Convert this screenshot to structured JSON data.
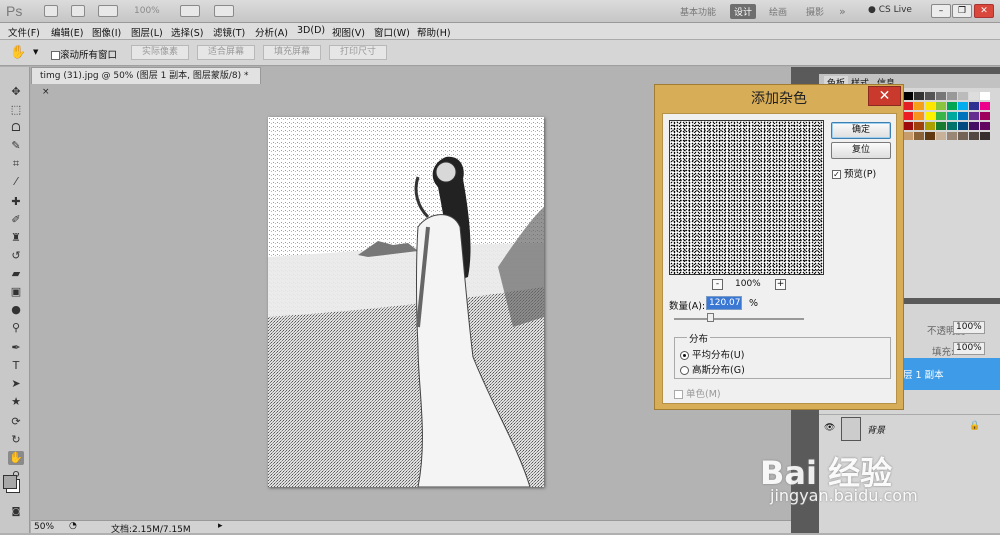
{
  "app": {
    "logo": "Ps",
    "zoom": "100%"
  },
  "workspaces": [
    "基本功能",
    "设计",
    "绘画",
    "摄影",
    "»"
  ],
  "cs_live": "CS Live",
  "menu": [
    "文件(F)",
    "编辑(E)",
    "图像(I)",
    "图层(L)",
    "选择(S)",
    "滤镜(T)",
    "分析(A)",
    "3D(D)",
    "视图(V)",
    "窗口(W)",
    "帮助(H)"
  ],
  "options": {
    "scroll_all": "滚动所有窗口",
    "actual_pixels": "实际像素",
    "fit_screen": "适合屏幕",
    "fill_screen": "填充屏幕",
    "print_size": "打印尺寸"
  },
  "document": {
    "tab_title": "timg (31).jpg @ 50% (图层 1 副本, 图层蒙版/8) *",
    "close": "×"
  },
  "status": {
    "zoom": "50%",
    "doc_info": "文档:2.15M/7.15M"
  },
  "panels": {
    "tabs": [
      "色板",
      "样式",
      "信息"
    ],
    "opacity_label": "不透明度:",
    "opacity_value": "100%",
    "fill_label": "填充:",
    "fill_value": "100%",
    "layer_name": "层 1 副本",
    "bg_layer_name": "背景"
  },
  "dialog": {
    "title": "添加杂色",
    "close": "✕",
    "ok": "确定",
    "reset": "复位",
    "preview_label": "预览(P)",
    "preview_checked": true,
    "zoom_minus": "-",
    "zoom_value": "100%",
    "zoom_plus": "+",
    "amount_label": "数量(A):",
    "amount_value": "120.07",
    "amount_unit": "%",
    "distribution_group": "分布",
    "uniform": "平均分布(U)",
    "gaussian": "高斯分布(G)",
    "uniform_selected": true,
    "monochromatic": "单色(M)"
  },
  "watermark": {
    "brand": "Bai  经验",
    "url": "jingyan.baidu.com"
  }
}
